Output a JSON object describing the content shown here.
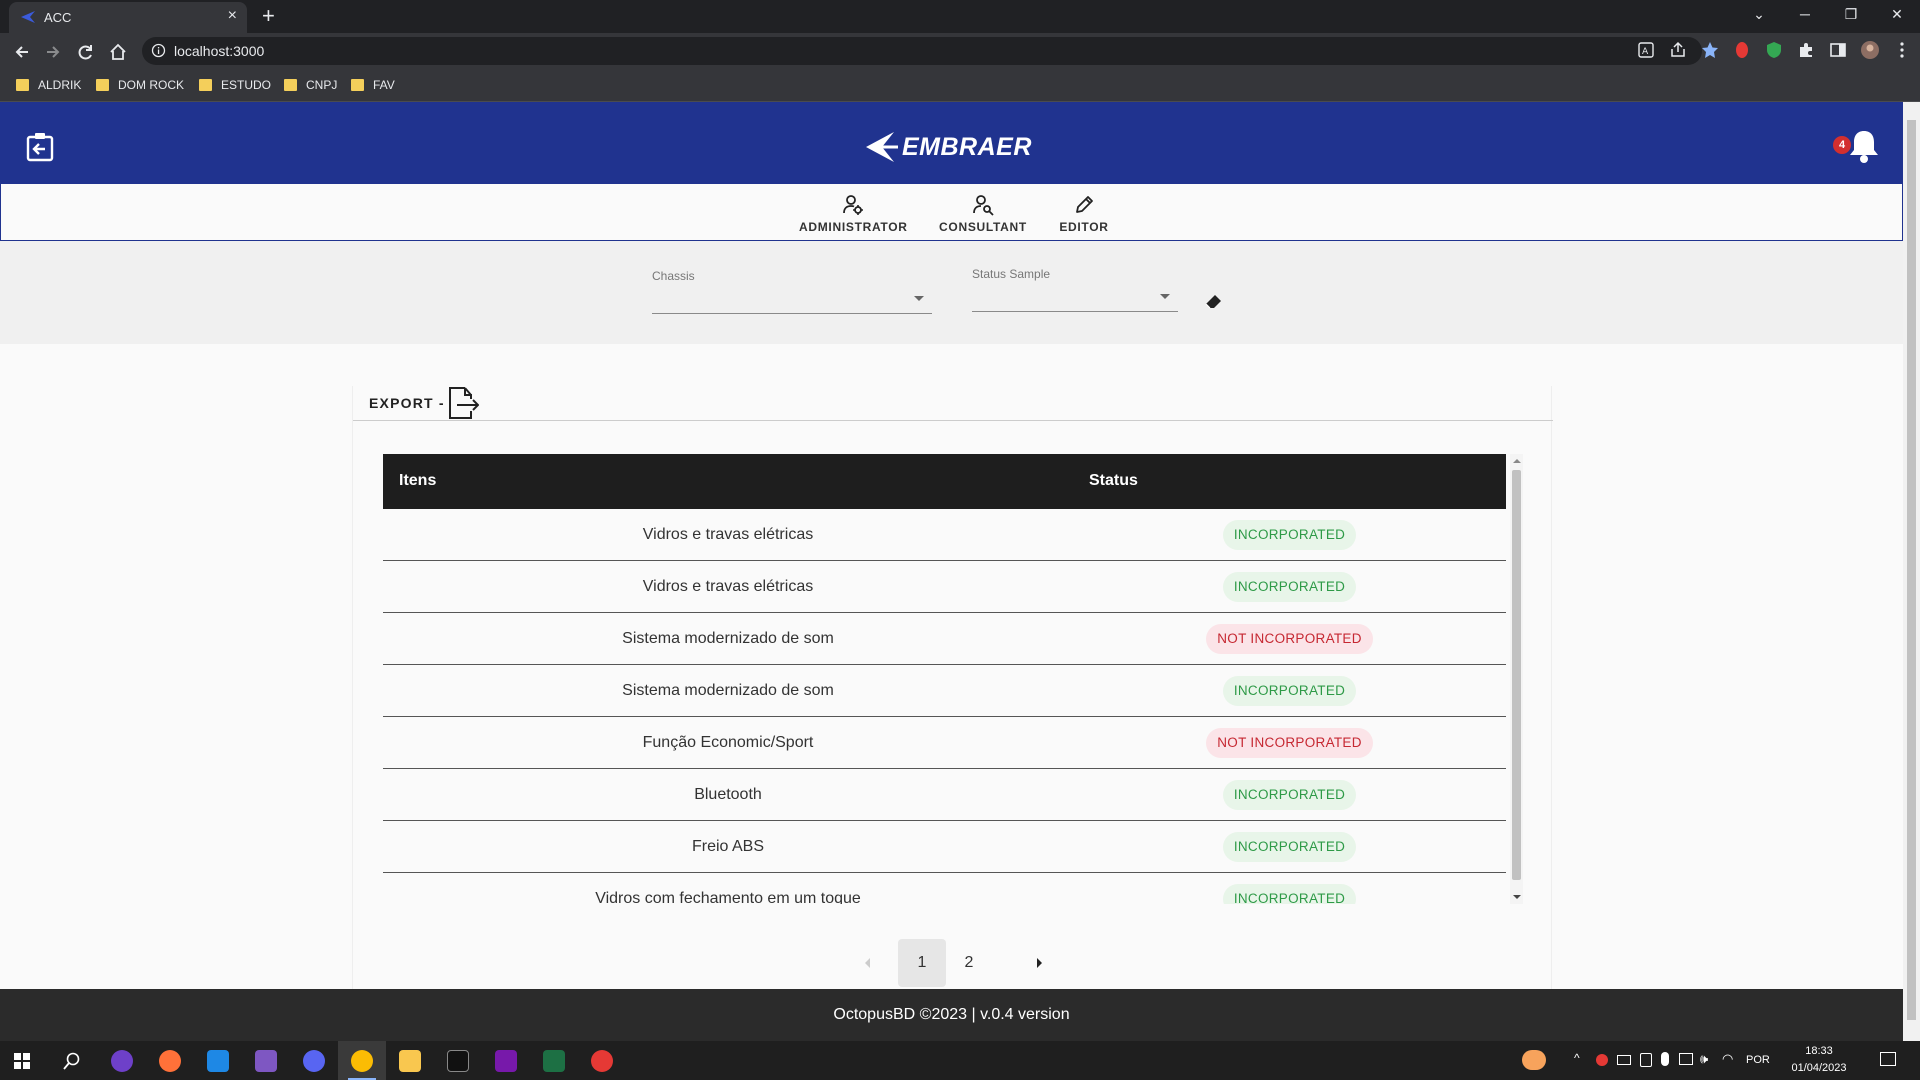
{
  "browser": {
    "tab_title": "ACC",
    "url": "localhost:3000",
    "bookmarks": [
      "ALDRIK",
      "DOM ROCK",
      "ESTUDO",
      "CNPJ",
      "FAV"
    ]
  },
  "header": {
    "brand": "EMBRAER",
    "notification_count": "4"
  },
  "roles": [
    {
      "label": "ADMINISTRATOR",
      "icon": "user-gear-icon"
    },
    {
      "label": "CONSULTANT",
      "icon": "user-search-icon"
    },
    {
      "label": "EDITOR",
      "icon": "pencil-icon"
    }
  ],
  "filters": {
    "chassis_label": "Chassis",
    "status_label": "Status Sample"
  },
  "export_label": "EXPORT -",
  "table": {
    "columns": [
      "Itens",
      "Status"
    ],
    "rows": [
      {
        "item": "Vidros e travas elétricas",
        "status": "INCORPORATED"
      },
      {
        "item": "Vidros e travas elétricas",
        "status": "INCORPORATED"
      },
      {
        "item": "Sistema modernizado de som",
        "status": "NOT INCORPORATED"
      },
      {
        "item": "Sistema modernizado de som",
        "status": "INCORPORATED"
      },
      {
        "item": "Função Economic/Sport",
        "status": "NOT INCORPORATED"
      },
      {
        "item": "Bluetooth",
        "status": "INCORPORATED"
      },
      {
        "item": "Freio ABS",
        "status": "INCORPORATED"
      },
      {
        "item": "Vidros com fechamento em um toque",
        "status": "INCORPORATED"
      }
    ]
  },
  "pagination": {
    "pages": [
      "1",
      "2"
    ],
    "current": "1"
  },
  "footer": "OctopusBD ©2023 | v.0.4 version",
  "taskbar": {
    "language": "POR",
    "time": "18:33",
    "date": "01/04/2023"
  },
  "colors": {
    "header_bg": "#20338f",
    "incorporated_bg": "#e8f5e9",
    "incorporated_text": "#2e9a47",
    "not_incorporated_bg": "#fbe4e8",
    "not_incorporated_text": "#c62832"
  }
}
